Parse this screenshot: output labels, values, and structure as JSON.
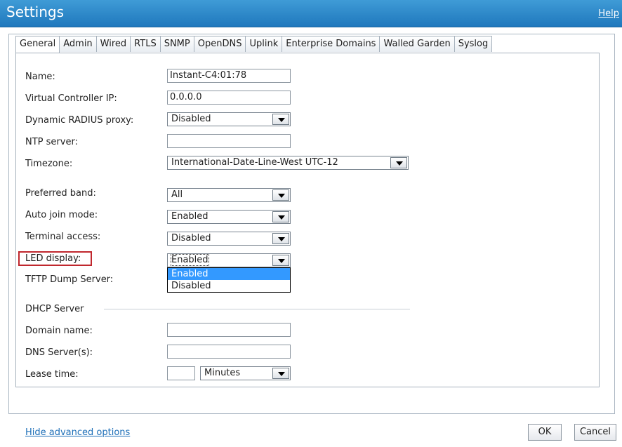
{
  "title": "Settings",
  "help_link": "Help",
  "tabs": [
    "General",
    "Admin",
    "Wired",
    "RTLS",
    "SNMP",
    "OpenDNS",
    "Uplink",
    "Enterprise Domains",
    "Walled Garden",
    "Syslog"
  ],
  "active_tab": "General",
  "fields": {
    "name": {
      "label": "Name:",
      "value": "Instant-C4:01:78"
    },
    "vc_ip": {
      "label": "Virtual Controller IP:",
      "value": "0.0.0.0"
    },
    "radius_proxy": {
      "label": "Dynamic RADIUS proxy:",
      "value": "Disabled"
    },
    "ntp": {
      "label": "NTP server:",
      "value": ""
    },
    "timezone": {
      "label": "Timezone:",
      "value": "International-Date-Line-West UTC-12"
    },
    "preferred_band": {
      "label": "Preferred band:",
      "value": "All"
    },
    "auto_join": {
      "label": "Auto join mode:",
      "value": "Enabled"
    },
    "terminal_access": {
      "label": "Terminal access:",
      "value": "Disabled"
    },
    "led_display": {
      "label": "LED display:",
      "value": "Enabled",
      "options": [
        "Enabled",
        "Disabled"
      ],
      "highlighted": "Enabled"
    },
    "tftp": {
      "label": "TFTP Dump Server:",
      "value": ""
    }
  },
  "dhcp": {
    "section_title": "DHCP Server",
    "domain": {
      "label": "Domain name:",
      "value": ""
    },
    "dns": {
      "label": "DNS Server(s):",
      "value": ""
    },
    "lease": {
      "label": "Lease time:",
      "value": "",
      "unit": "Minutes"
    }
  },
  "footer": {
    "hide_link": "Hide advanced options",
    "ok": "OK",
    "cancel": "Cancel"
  },
  "colors": {
    "titlebar": "#2a87cb",
    "link": "#1e6fb8",
    "highlight_box": "#c0272d",
    "dropdown_selected": "#3399ff"
  },
  "icons": {
    "select_arrow": "chevron-down-icon"
  }
}
